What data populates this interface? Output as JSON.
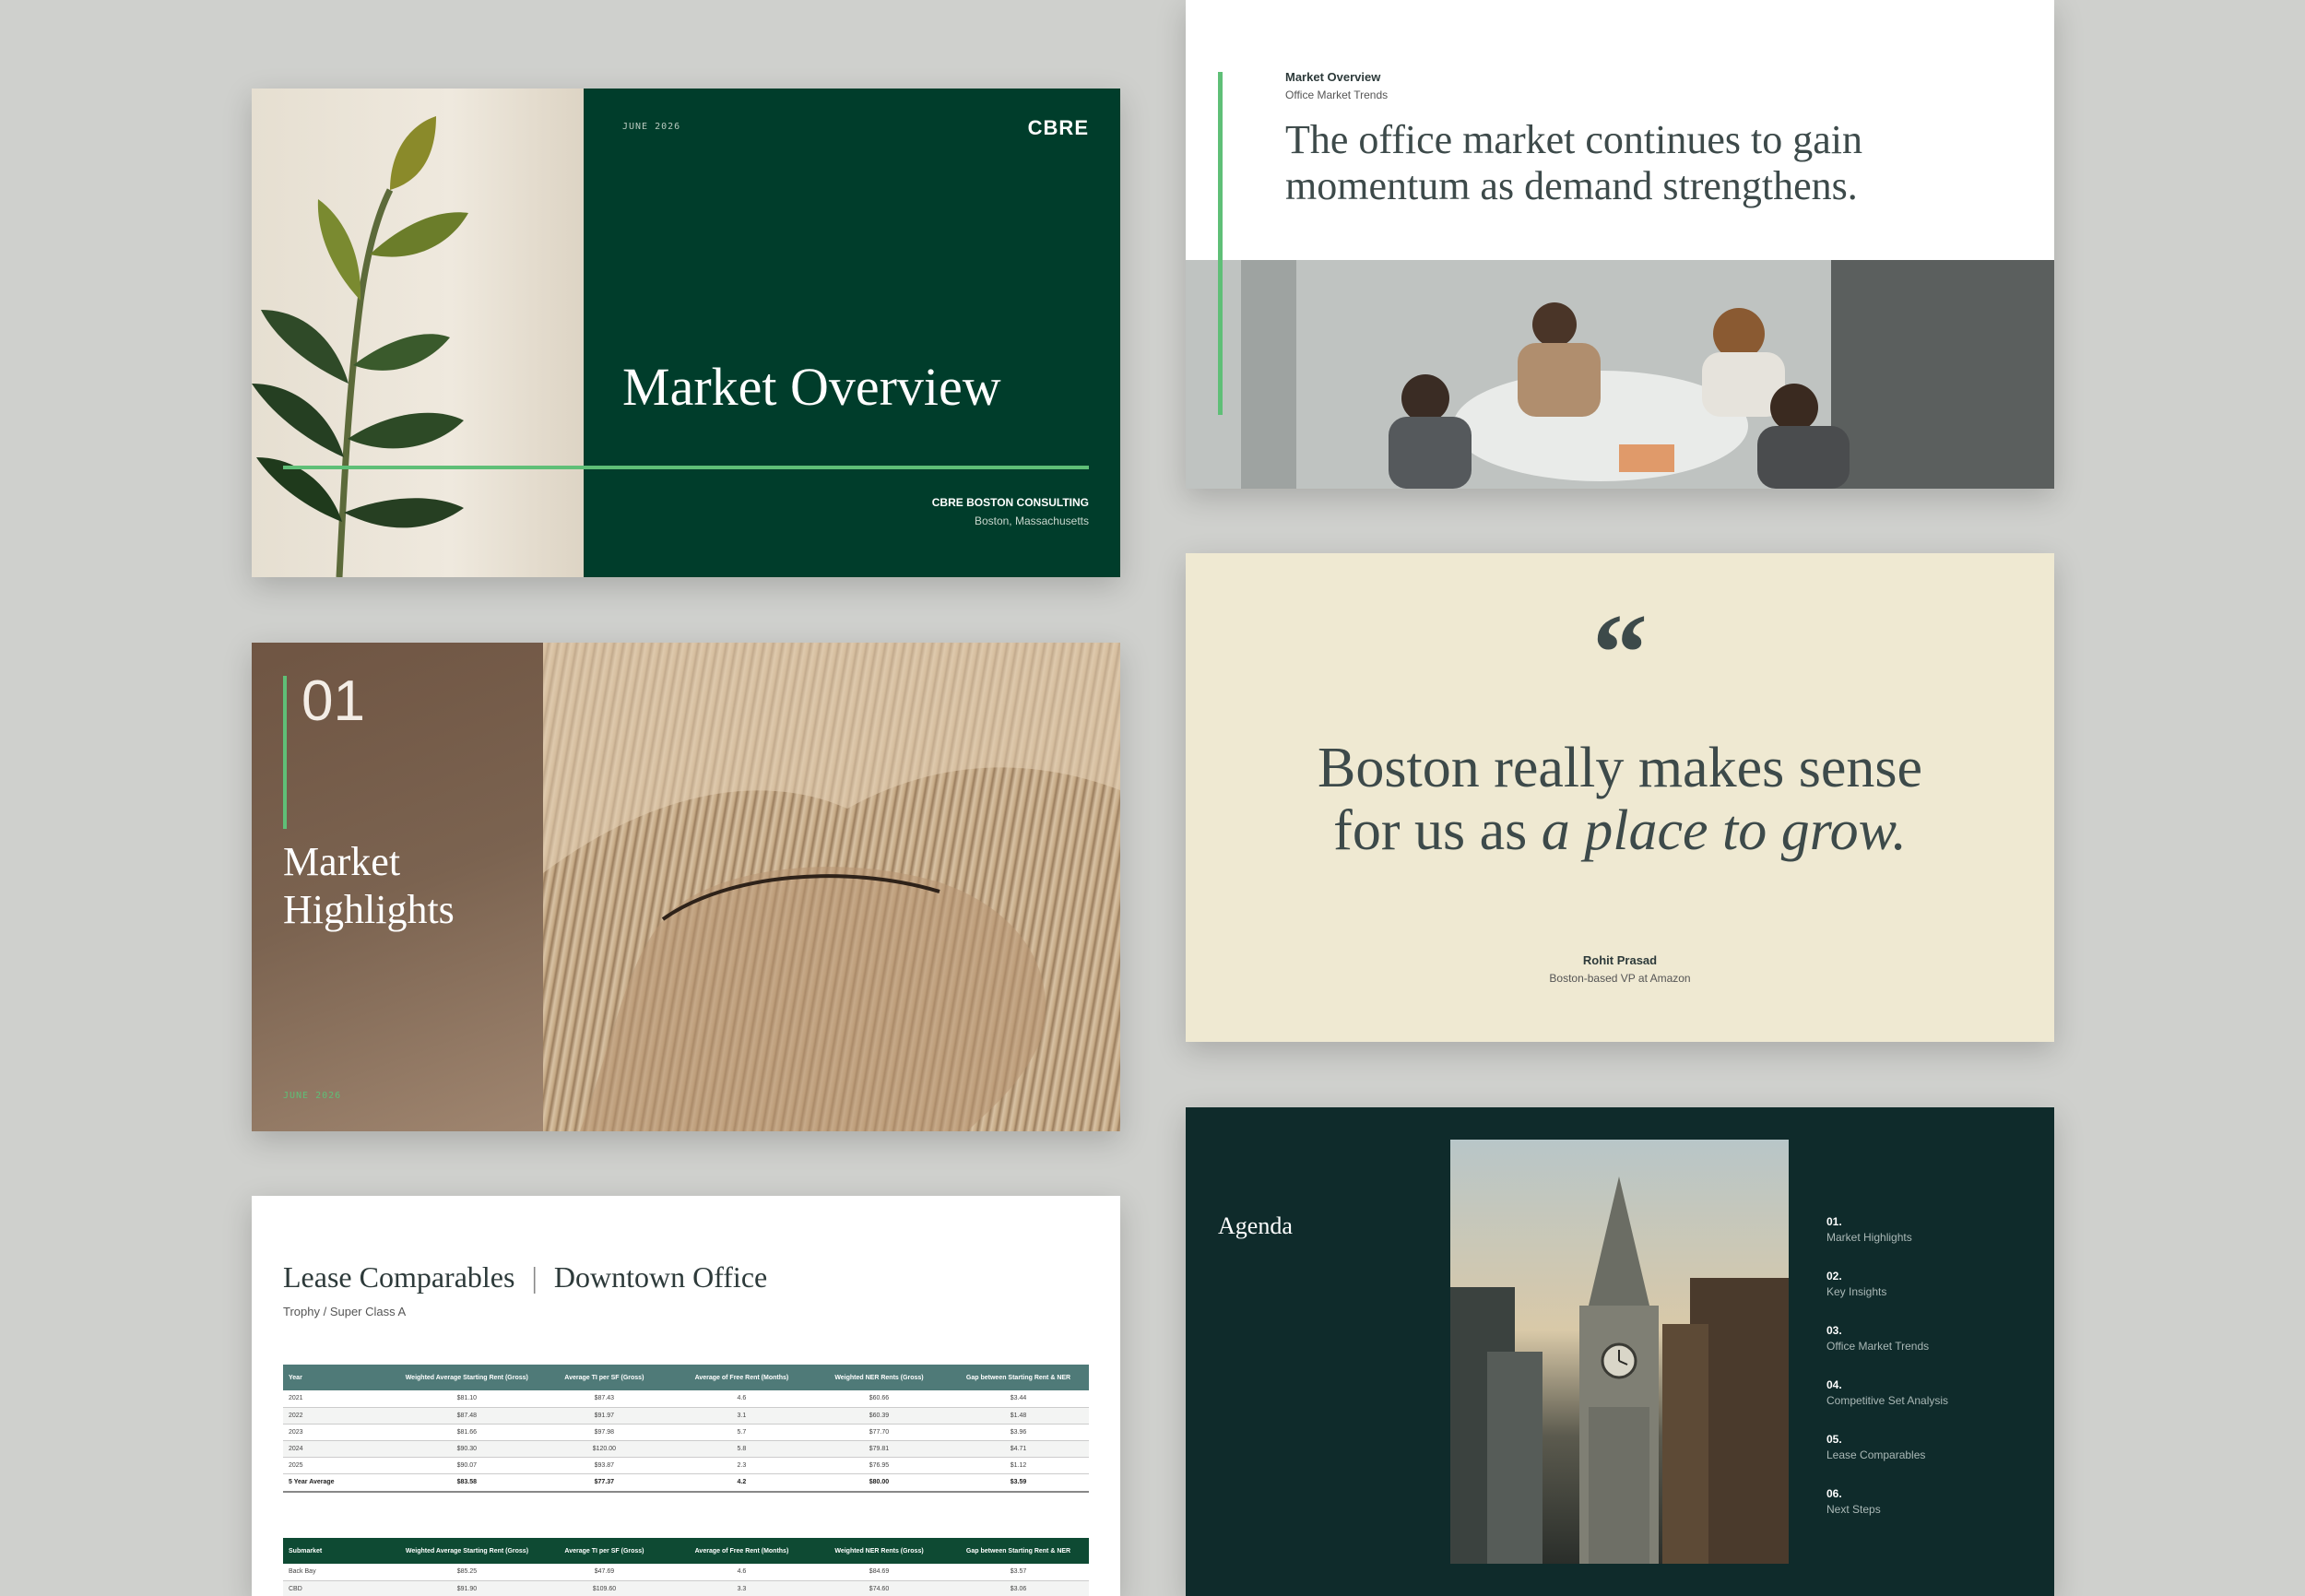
{
  "cover": {
    "date": "JUNE 2026",
    "logo": "CBRE",
    "title": "Market Overview",
    "firm": "CBRE BOSTON CONSULTING",
    "location": "Boston, Massachusetts",
    "colors": {
      "panel": "#003d2b",
      "accent": "#5fbf77"
    }
  },
  "office": {
    "section": "Market Overview",
    "subsection": "Office Market Trends",
    "headline_line1": "The office market continues to gain",
    "headline_line2": "momentum as demand strengthens."
  },
  "highlights": {
    "number": "01",
    "title_line1": "Market",
    "title_line2": "Highlights",
    "date": "JUNE 2026"
  },
  "quote": {
    "mark": "“",
    "line1": "Boston really makes sense",
    "line2_plain": "for us as ",
    "line2_italic": "a place to grow.",
    "author": "Rohit Prasad",
    "author_title": "Boston-based VP at Amazon",
    "colors": {
      "bg": "#efe9d2",
      "text": "#3d4a4a"
    }
  },
  "lease": {
    "title": "Lease Comparables",
    "divider": "|",
    "subtitle_right": "Downtown Office",
    "subtitle": "Trophy / Super Class A",
    "table1": {
      "headers": [
        "Year",
        "Weighted Average Starting Rent (Gross)",
        "Average TI per SF (Gross)",
        "Average of Free Rent (Months)",
        "Weighted NER Rents (Gross)",
        "Gap between Starting Rent & NER"
      ],
      "rows": [
        [
          "2021",
          "$81.10",
          "$87.43",
          "4.6",
          "$60.66",
          "$3.44"
        ],
        [
          "2022",
          "$87.48",
          "$91.97",
          "3.1",
          "$60.39",
          "$1.48"
        ],
        [
          "2023",
          "$81.66",
          "$97.98",
          "5.7",
          "$77.70",
          "$3.96"
        ],
        [
          "2024",
          "$90.30",
          "$120.00",
          "5.8",
          "$79.81",
          "$4.71"
        ],
        [
          "2025",
          "$90.07",
          "$93.87",
          "2.3",
          "$76.95",
          "$1.12"
        ]
      ],
      "total": [
        "5 Year Average",
        "$83.58",
        "$77.37",
        "4.2",
        "$80.00",
        "$3.59"
      ]
    },
    "table2": {
      "headers": [
        "Submarket",
        "Weighted Average Starting Rent (Gross)",
        "Average TI per SF (Gross)",
        "Average of Free Rent (Months)",
        "Weighted NER Rents (Gross)",
        "Gap between Starting Rent & NER"
      ],
      "rows": [
        [
          "Back Bay",
          "$85.25",
          "$47.69",
          "4.6",
          "$84.69",
          "$3.57"
        ],
        [
          "CBD",
          "$91.90",
          "$109.60",
          "3.3",
          "$74.60",
          "$3.06"
        ]
      ]
    },
    "colors": {
      "header1": "#4f7a78",
      "header2": "#0e4a33"
    }
  },
  "agenda": {
    "title": "Agenda",
    "items": [
      {
        "num": "01.",
        "label": "Market Highlights"
      },
      {
        "num": "02.",
        "label": "Key Insights"
      },
      {
        "num": "03.",
        "label": "Office Market Trends"
      },
      {
        "num": "04.",
        "label": "Competitive Set Analysis"
      },
      {
        "num": "05.",
        "label": "Lease Comparables"
      },
      {
        "num": "06.",
        "label": "Next Steps"
      }
    ],
    "colors": {
      "bg": "#0f2b2b"
    }
  }
}
